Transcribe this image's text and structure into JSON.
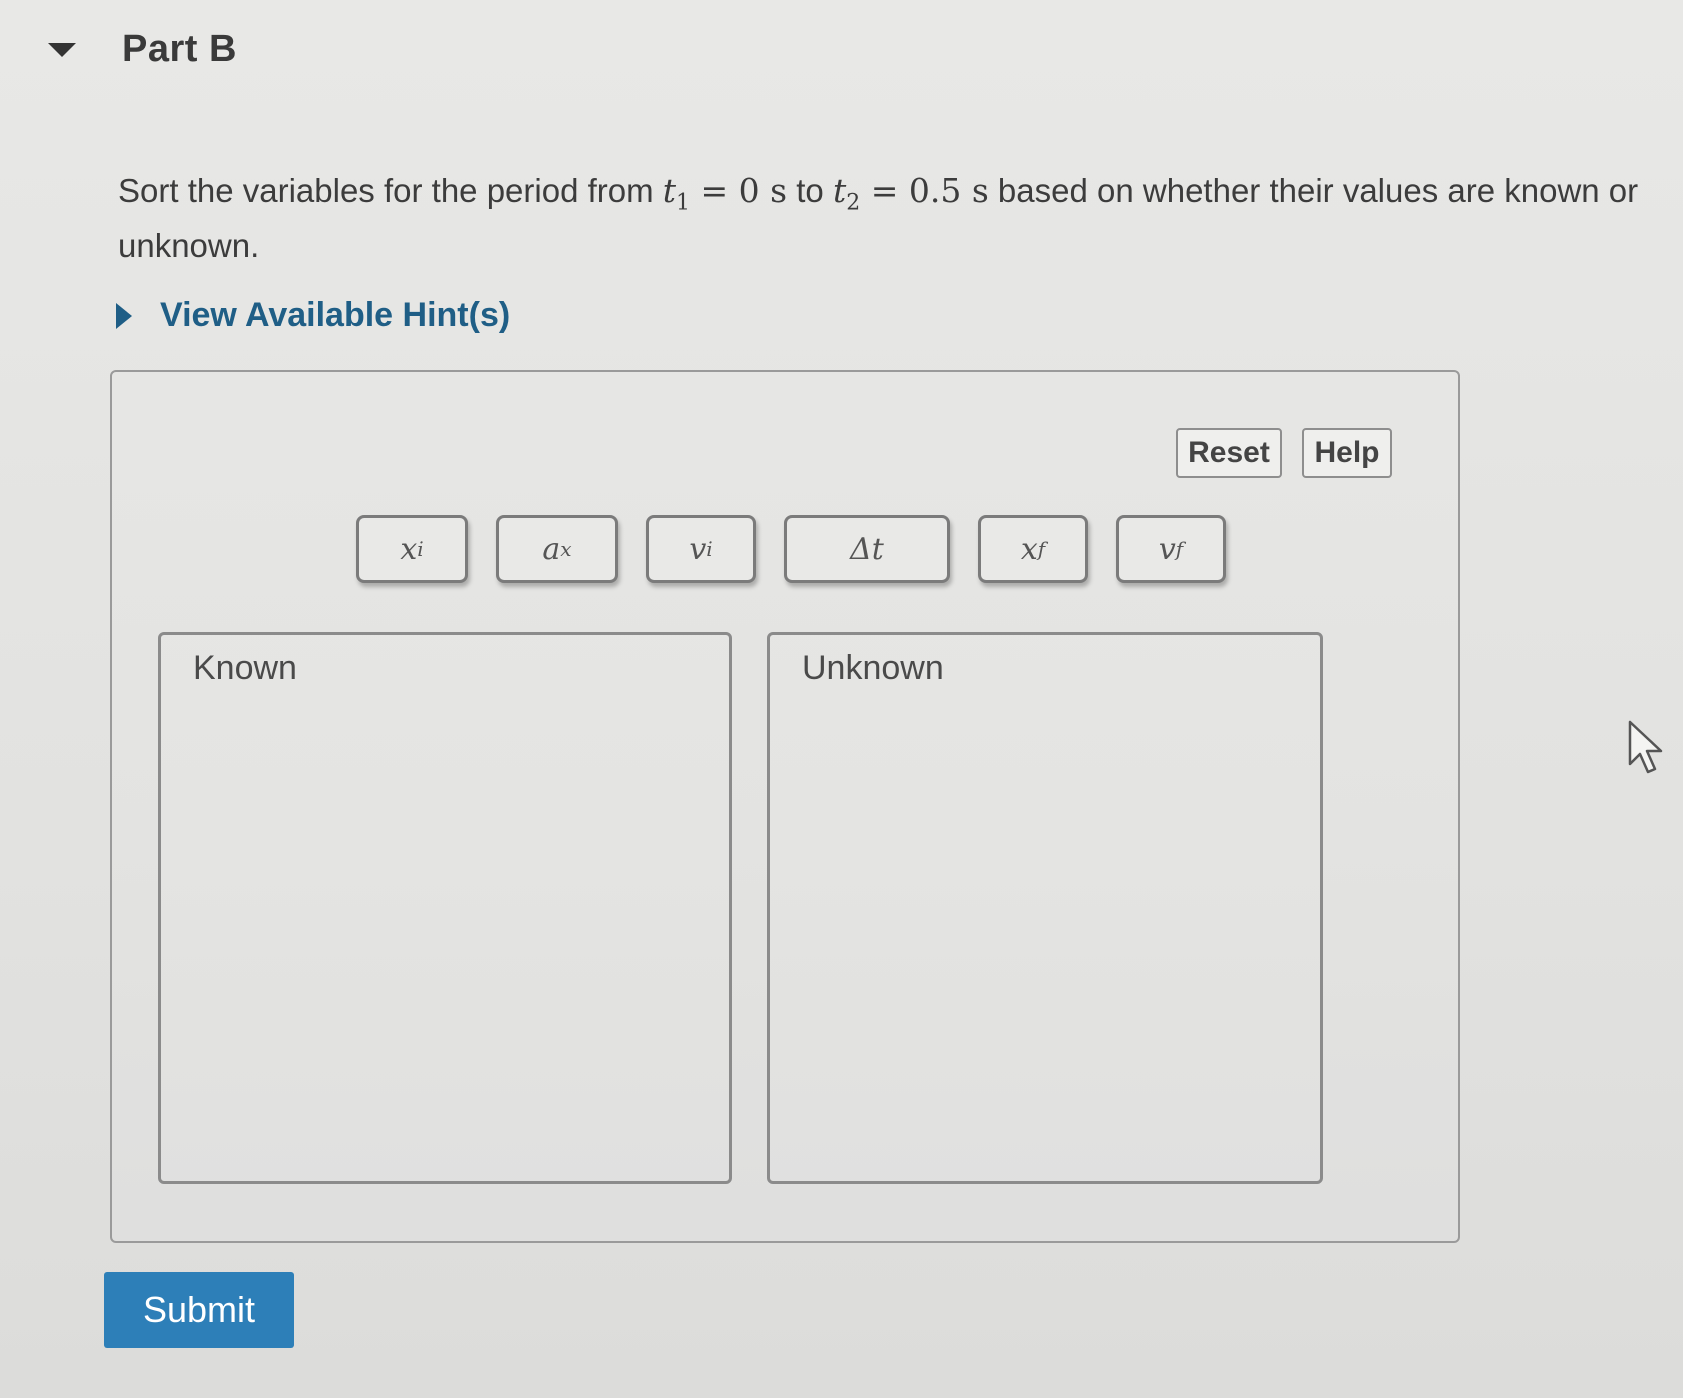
{
  "part": {
    "title": "Part B"
  },
  "prompt": {
    "text_before": "Sort the variables for the period from ",
    "t1_symbol": "t",
    "t1_sub": "1",
    "t1_value": " = 0 s",
    "to_word": " to ",
    "t2_symbol": "t",
    "t2_sub": "2",
    "t2_value": " = 0.5 s",
    "text_after": " based on whether their values are known or unknown."
  },
  "hints": {
    "label": "View Available Hint(s)"
  },
  "controls": {
    "reset_label": "Reset",
    "help_label": "Help"
  },
  "tokens": [
    {
      "base": "x",
      "sub": "i"
    },
    {
      "base": "a",
      "sub": "x"
    },
    {
      "base": "v",
      "sub": "i"
    },
    {
      "base": "Δt",
      "sub": ""
    },
    {
      "base": "x",
      "sub": "f"
    },
    {
      "base": "v",
      "sub": "f"
    }
  ],
  "bins": {
    "known_label": "Known",
    "unknown_label": "Unknown"
  },
  "submit": {
    "label": "Submit"
  },
  "colors": {
    "link": "#1f5e86",
    "submit_bg": "#2d7fb8"
  },
  "icons": {
    "collapse": "triangle-down-icon",
    "hints": "triangle-right-icon",
    "cursor": "mouse-pointer-icon"
  }
}
